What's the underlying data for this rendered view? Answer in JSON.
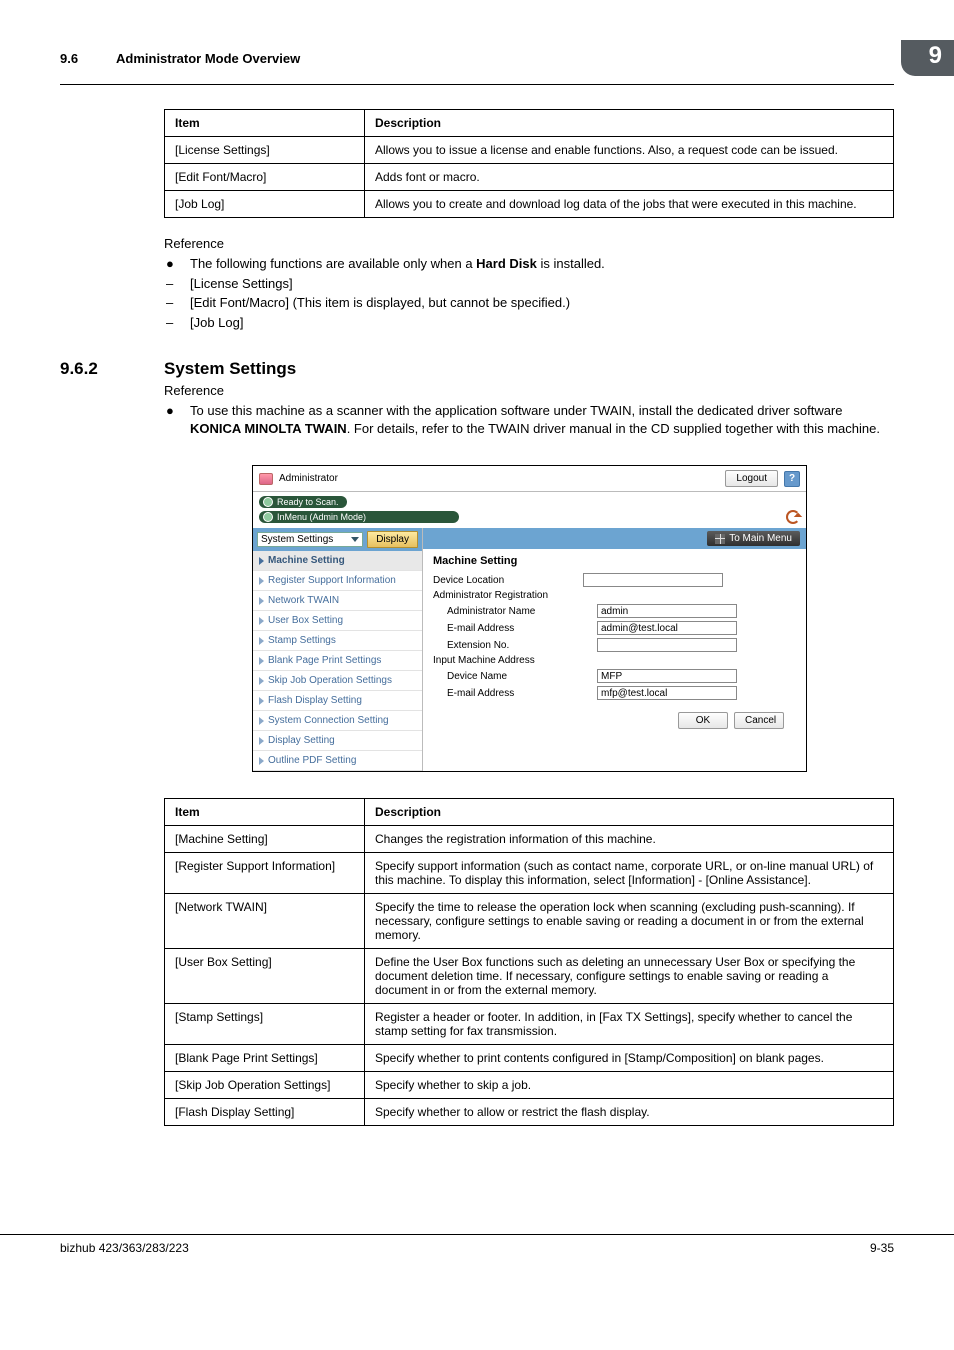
{
  "header": {
    "section_number": "9.6",
    "section_title": "Administrator Mode Overview",
    "chapter_badge": "9"
  },
  "table1": {
    "headers": {
      "item": "Item",
      "desc": "Description"
    },
    "rows": [
      {
        "item": "[License Settings]",
        "desc": "Allows you to issue a license and enable functions. Also, a request code can be issued."
      },
      {
        "item": "[Edit Font/Macro]",
        "desc": "Adds font or macro."
      },
      {
        "item": "[Job Log]",
        "desc": "Allows you to create and download log data of the jobs that were executed in this machine."
      }
    ]
  },
  "ref1": {
    "label": "Reference",
    "bullet": "The following functions are available only when a ",
    "bullet_strong": "Hard Disk",
    "bullet_tail": " is installed.",
    "items": [
      "[License Settings]",
      "[Edit Font/Macro] (This item is displayed, but cannot be specified.)",
      "[Job Log]"
    ]
  },
  "h2": {
    "num": "9.6.2",
    "title": "System Settings"
  },
  "ref2": {
    "label": "Reference",
    "line1a": "To use this machine as a scanner with the application software under TWAIN, install the dedicated driver software ",
    "line1b": "KONICA MINOLTA TWAIN",
    "line1c": ". For details, refer to the TWAIN driver manual in the CD supplied together with this machine."
  },
  "screenshot": {
    "top": {
      "admin": "Administrator",
      "logout": "Logout",
      "help": "?"
    },
    "status1": "Ready to Scan.",
    "status2": "InMenu (Admin Mode)",
    "select_value": "System Settings",
    "display_btn": "Display",
    "tomain": "To Main Menu",
    "sidebar": [
      "Machine Setting",
      "Register Support Information",
      "Network TWAIN",
      "User Box Setting",
      "Stamp Settings",
      "Blank Page Print Settings",
      "Skip Job Operation Settings",
      "Flash Display Setting",
      "System Connection Setting",
      "Display Setting",
      "Outline PDF Setting"
    ],
    "main_title": "Machine Setting",
    "device_location": "Device Location",
    "admin_reg": "Administrator Registration",
    "admin_name_lbl": "Administrator Name",
    "admin_name_val": "admin",
    "email_lbl": "E-mail Address",
    "email_val": "admin@test.local",
    "ext_lbl": "Extension No.",
    "ext_val": "",
    "input_machine": "Input Machine Address",
    "devname_lbl": "Device Name",
    "devname_val": "MFP",
    "email2_lbl": "E-mail Address",
    "email2_val": "mfp@test.local",
    "ok": "OK",
    "cancel": "Cancel"
  },
  "table2": {
    "headers": {
      "item": "Item",
      "desc": "Description"
    },
    "rows": [
      {
        "item": "[Machine Setting]",
        "desc": "Changes the registration information of this machine."
      },
      {
        "item": "[Register Support Information]",
        "desc": "Specify support information (such as contact name, corporate URL, or on-line manual URL) of this machine. To display this information, select [Information] - [Online Assistance]."
      },
      {
        "item": "[Network TWAIN]",
        "desc": "Specify the time to release the operation lock when scanning (excluding push-scanning). If necessary, configure settings to enable saving or reading a document in or from the external memory."
      },
      {
        "item": "[User Box Setting]",
        "desc": "Define the User Box functions such as deleting an unnecessary User Box or specifying the document deletion time. If necessary, configure settings to enable saving or reading a document in or from the external memory."
      },
      {
        "item": "[Stamp Settings]",
        "desc": "Register a header or footer. In addition, in [Fax TX Settings], specify whether to cancel the stamp setting for fax transmission."
      },
      {
        "item": "[Blank Page Print Settings]",
        "desc": "Specify whether to print contents configured in [Stamp/Composition] on blank pages."
      },
      {
        "item": "[Skip Job Operation Settings]",
        "desc": "Specify whether to skip a job."
      },
      {
        "item": "[Flash Display Setting]",
        "desc": "Specify whether to allow or restrict the flash display."
      }
    ]
  },
  "footer": {
    "left": "bizhub 423/363/283/223",
    "right": "9-35"
  }
}
